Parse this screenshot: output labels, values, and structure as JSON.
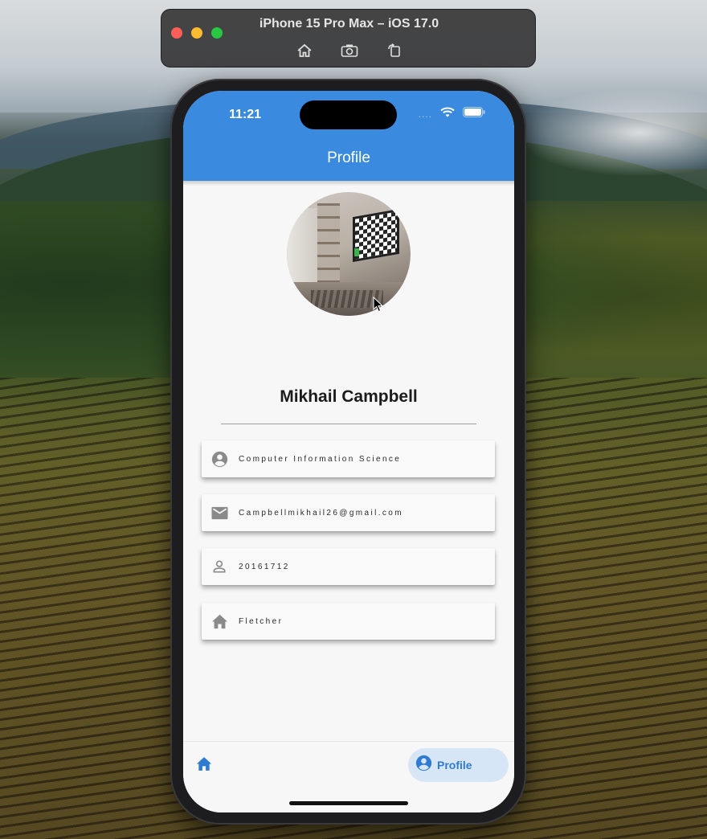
{
  "simulator": {
    "title": "iPhone 15 Pro Max – iOS 17.0",
    "tools": [
      "home-icon",
      "screenshot-icon",
      "rotate-icon"
    ]
  },
  "status_bar": {
    "time": "11:21",
    "signal_dots": "....",
    "icons": [
      "wifi-icon",
      "battery-icon"
    ]
  },
  "app_bar": {
    "title": "Profile",
    "color": "#3a8ae0"
  },
  "profile": {
    "name": "Mikhail Campbell",
    "avatar": "profile-photo"
  },
  "info_items": [
    {
      "icon": "account-circle-icon",
      "text": "Computer Information Science"
    },
    {
      "icon": "email-icon",
      "text": "Campbellmikhail26@gmail.com"
    },
    {
      "icon": "person-outline-icon",
      "text": "20161712"
    },
    {
      "icon": "home-icon",
      "text": "Fletcher"
    }
  ],
  "bottom_nav": {
    "items": [
      {
        "icon": "home-icon",
        "label": ""
      },
      {
        "icon": "account-circle-icon",
        "label": "Profile",
        "selected": true
      }
    ],
    "accent": "#2f7bd1"
  }
}
